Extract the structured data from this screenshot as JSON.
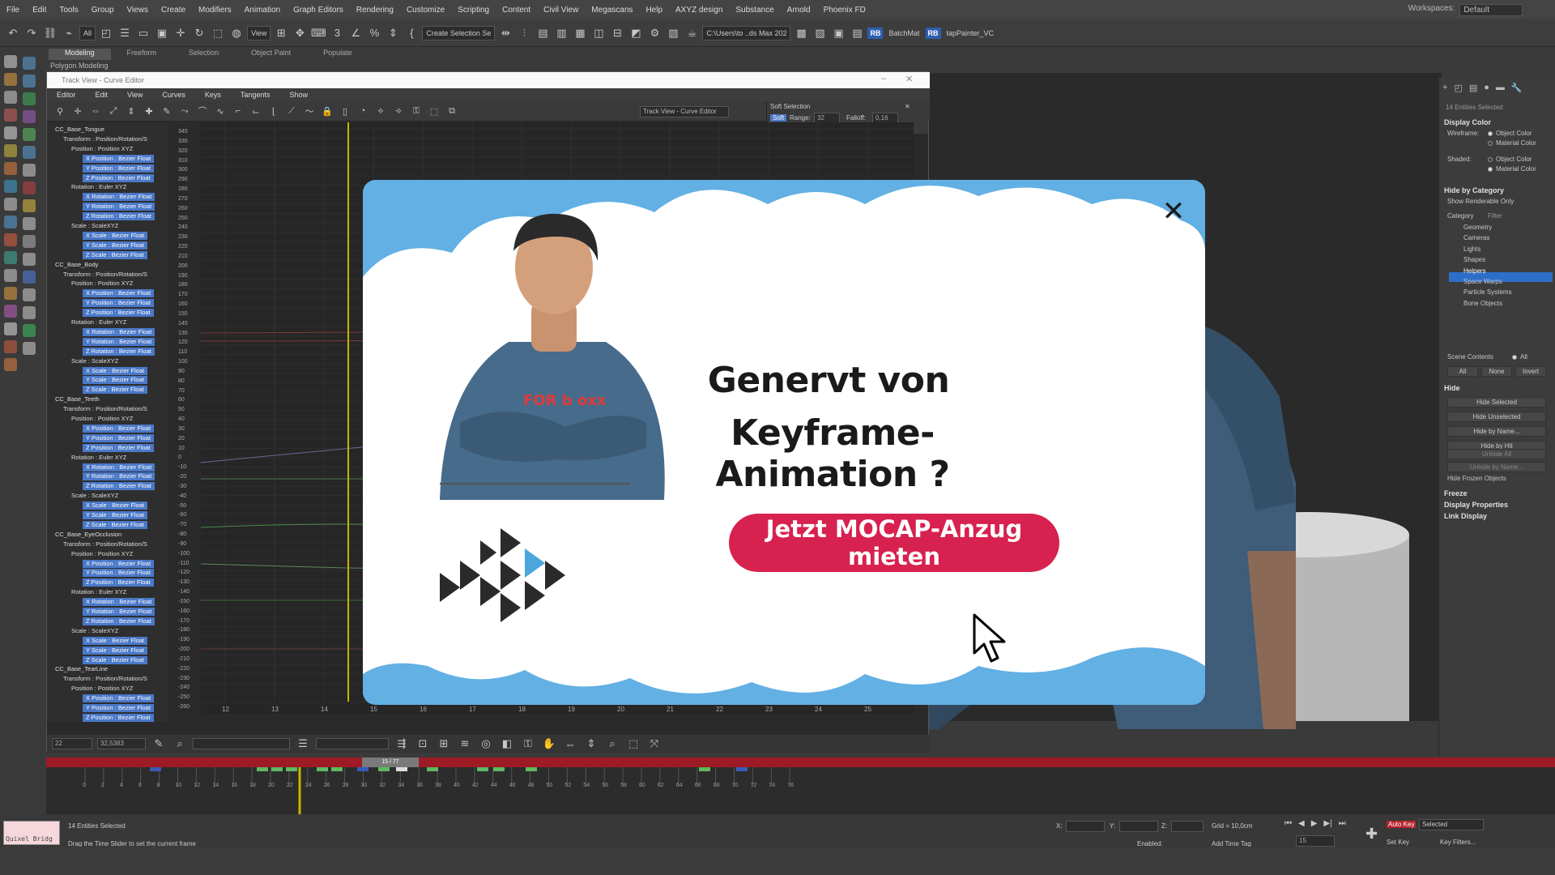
{
  "menubar": {
    "items": [
      "File",
      "Edit",
      "Tools",
      "Group",
      "Views",
      "Create",
      "Modifiers",
      "Animation",
      "Graph Editors",
      "Rendering",
      "Customize",
      "Scripting",
      "Content",
      "Civil View",
      "Megascans",
      "Help",
      "AXYZ design",
      "Substance",
      "Arnold",
      "Phoenix FD"
    ],
    "workspace_label": "Workspaces:",
    "workspace_value": "Default"
  },
  "toolbar": {
    "filter_value": "All",
    "view_value": "View",
    "create_selection_label": "Create Selection Se",
    "path_value": "C:\\Users\\to ..ds Max 202",
    "batchmat_label": "BatchMat",
    "tappainter_label": "tapPainter_VC",
    "rb_label": "RB"
  },
  "ribbon": {
    "tabs": [
      "Modeling",
      "Freeform",
      "Selection",
      "Object Paint",
      "Populate"
    ],
    "active_tab": "Modeling",
    "sub_label": "Polygon Modeling"
  },
  "trackview": {
    "title": "Track View - Curve Editor",
    "menu": [
      "Editor",
      "Edit",
      "View",
      "Curves",
      "Keys",
      "Tangents",
      "Show"
    ],
    "toolbar_field": "Track View - Curve Editor",
    "soft_selection": {
      "title": "Soft Selection",
      "soft_btn": "Soft",
      "range_label": "Range:",
      "range_value": "32",
      "falloff_label": "Falloff:",
      "falloff_value": "0,16"
    },
    "tree": [
      {
        "text": "CC_Base_Tongue",
        "level": 0,
        "hl": false
      },
      {
        "text": "Transform : Position/Rotation/S",
        "level": 1,
        "hl": false
      },
      {
        "text": "Position : Position XYZ",
        "level": 2,
        "hl": false
      },
      {
        "text": "X Position : Bezier Float",
        "level": 3,
        "hl": true
      },
      {
        "text": "Y Position : Bezier Float",
        "level": 3,
        "hl": true
      },
      {
        "text": "Z Position : Bezier Float",
        "level": 3,
        "hl": true
      },
      {
        "text": "Rotation : Euler XYZ",
        "level": 2,
        "hl": false
      },
      {
        "text": "X Rotation : Bezier Float",
        "level": 3,
        "hl": true
      },
      {
        "text": "Y Rotation : Bezier Float",
        "level": 3,
        "hl": true
      },
      {
        "text": "Z Rotation : Bezier Float",
        "level": 3,
        "hl": true
      },
      {
        "text": "Scale : ScaleXYZ",
        "level": 2,
        "hl": false
      },
      {
        "text": "X Scale : Bezier Float",
        "level": 3,
        "hl": true
      },
      {
        "text": "Y Scale : Bezier Float",
        "level": 3,
        "hl": true
      },
      {
        "text": "Z Scale : Bezier Float",
        "level": 3,
        "hl": true
      },
      {
        "text": "CC_Base_Body",
        "level": 0,
        "hl": false
      },
      {
        "text": "Transform : Position/Rotation/S",
        "level": 1,
        "hl": false
      },
      {
        "text": "Position : Position XYZ",
        "level": 2,
        "hl": false
      },
      {
        "text": "X Position : Bezier Float",
        "level": 3,
        "hl": true
      },
      {
        "text": "Y Position : Bezier Float",
        "level": 3,
        "hl": true
      },
      {
        "text": "Z Position : Bezier Float",
        "level": 3,
        "hl": true
      },
      {
        "text": "Rotation : Euler XYZ",
        "level": 2,
        "hl": false
      },
      {
        "text": "X Rotation : Bezier Float",
        "level": 3,
        "hl": true
      },
      {
        "text": "Y Rotation : Bezier Float",
        "level": 3,
        "hl": true
      },
      {
        "text": "Z Rotation : Bezier Float",
        "level": 3,
        "hl": true
      },
      {
        "text": "Scale : ScaleXYZ",
        "level": 2,
        "hl": false
      },
      {
        "text": "X Scale : Bezier Float",
        "level": 3,
        "hl": true
      },
      {
        "text": "Y Scale : Bezier Float",
        "level": 3,
        "hl": true
      },
      {
        "text": "Z Scale : Bezier Float",
        "level": 3,
        "hl": true
      },
      {
        "text": "CC_Base_Teeth",
        "level": 0,
        "hl": false
      },
      {
        "text": "Transform : Position/Rotation/S",
        "level": 1,
        "hl": false
      },
      {
        "text": "Position : Position XYZ",
        "level": 2,
        "hl": false
      },
      {
        "text": "X Position : Bezier Float",
        "level": 3,
        "hl": true
      },
      {
        "text": "Y Position : Bezier Float",
        "level": 3,
        "hl": true
      },
      {
        "text": "Z Position : Bezier Float",
        "level": 3,
        "hl": true
      },
      {
        "text": "Rotation : Euler XYZ",
        "level": 2,
        "hl": false
      },
      {
        "text": "X Rotation : Bezier Float",
        "level": 3,
        "hl": true
      },
      {
        "text": "Y Rotation : Bezier Float",
        "level": 3,
        "hl": true
      },
      {
        "text": "Z Rotation : Bezier Float",
        "level": 3,
        "hl": true
      },
      {
        "text": "Scale : ScaleXYZ",
        "level": 2,
        "hl": false
      },
      {
        "text": "X Scale : Bezier Float",
        "level": 3,
        "hl": true
      },
      {
        "text": "Y Scale : Bezier Float",
        "level": 3,
        "hl": true
      },
      {
        "text": "Z Scale : Bezier Float",
        "level": 3,
        "hl": true
      },
      {
        "text": "CC_Base_EyeOcclusion",
        "level": 0,
        "hl": false
      },
      {
        "text": "Transform : Position/Rotation/S",
        "level": 1,
        "hl": false
      },
      {
        "text": "Position : Position XYZ",
        "level": 2,
        "hl": false
      },
      {
        "text": "X Position : Bezier Float",
        "level": 3,
        "hl": true
      },
      {
        "text": "Y Position : Bezier Float",
        "level": 3,
        "hl": true
      },
      {
        "text": "Z Position : Bezier Float",
        "level": 3,
        "hl": true
      },
      {
        "text": "Rotation : Euler XYZ",
        "level": 2,
        "hl": false
      },
      {
        "text": "X Rotation : Bezier Float",
        "level": 3,
        "hl": true
      },
      {
        "text": "Y Rotation : Bezier Float",
        "level": 3,
        "hl": true
      },
      {
        "text": "Z Rotation : Bezier Float",
        "level": 3,
        "hl": true
      },
      {
        "text": "Scale : ScaleXYZ",
        "level": 2,
        "hl": false
      },
      {
        "text": "X Scale : Bezier Float",
        "level": 3,
        "hl": true
      },
      {
        "text": "Y Scale : Bezier Float",
        "level": 3,
        "hl": true
      },
      {
        "text": "Z Scale : Bezier Float",
        "level": 3,
        "hl": true
      },
      {
        "text": "CC_Base_TearLine",
        "level": 0,
        "hl": false
      },
      {
        "text": "Transform : Position/Rotation/S",
        "level": 1,
        "hl": false
      },
      {
        "text": "Position : Position XYZ",
        "level": 2,
        "hl": false
      },
      {
        "text": "X Position : Bezier Float",
        "level": 3,
        "hl": true
      },
      {
        "text": "Y Position : Bezier Float",
        "level": 3,
        "hl": true
      },
      {
        "text": "Z Position : Bezier Float",
        "level": 3,
        "hl": true
      }
    ],
    "y_ticks": [
      "340",
      "330",
      "320",
      "310",
      "300",
      "290",
      "280",
      "270",
      "260",
      "250",
      "240",
      "230",
      "220",
      "210",
      "200",
      "190",
      "180",
      "170",
      "160",
      "150",
      "140",
      "130",
      "120",
      "110",
      "100",
      "90",
      "80",
      "70",
      "60",
      "50",
      "40",
      "30",
      "20",
      "10",
      "0",
      "-10",
      "-20",
      "-30",
      "-40",
      "-50",
      "-60",
      "-70",
      "-80",
      "-90",
      "-100",
      "-110",
      "-120",
      "-130",
      "-140",
      "-150",
      "-160",
      "-170",
      "-180",
      "-190",
      "-200",
      "-210",
      "-220",
      "-230",
      "-240",
      "-250",
      "-260"
    ],
    "x_ticks": [
      "12",
      "13",
      "14",
      "15",
      "16",
      "17",
      "18",
      "19",
      "20",
      "21",
      "22",
      "23",
      "24",
      "25"
    ],
    "bottom_field1": "22",
    "bottom_field2": "32,5383"
  },
  "timeline": {
    "slider_label": "15 / 77",
    "ticks": [
      "0",
      "2",
      "4",
      "6",
      "8",
      "10",
      "12",
      "14",
      "16",
      "18",
      "20",
      "22",
      "24",
      "26",
      "28",
      "30",
      "32",
      "34",
      "36",
      "38",
      "40",
      "42",
      "44",
      "46",
      "48",
      "50",
      "52",
      "54",
      "56",
      "58",
      "60",
      "62",
      "64",
      "66",
      "68",
      "70",
      "72",
      "74",
      "76"
    ]
  },
  "status": {
    "quixel_label": "Quixel Bridg",
    "entities": "14 Entities Selected",
    "hint": "Drag the Time Slider to set the current frame",
    "x_label": "X:",
    "y_label": "Y:",
    "z_label": "Z:",
    "grid": "Grid = 10,0cm",
    "enabled_label": "Enabled:",
    "add_time_tag": "Add Time Tag",
    "auto_key": "Auto Key",
    "selected": "Selected",
    "set_key": "Set Key",
    "key_filters": "Key Filters...",
    "frame": "15"
  },
  "cmdpanel": {
    "selected_label": "14 Entities Selected",
    "display_color": "Display Color",
    "wireframe_label": "Wireframe:",
    "shaded_label": "Shaded:",
    "object_color": "Object Color",
    "material_color": "Material Color",
    "hide_by_category": "Hide by Category",
    "show_renderable": "Show Renderable Only",
    "category_tab": "Category",
    "filter_tab": "Filter",
    "categories": [
      "Geometry",
      "Cameras",
      "Lights",
      "Shapes",
      "Helpers",
      "Space Warps",
      "Particle Systems",
      "Bone Objects"
    ],
    "selected_category": "Helpers",
    "scene_contents": "Scene Contents",
    "all_label": "All",
    "btn_all": "All",
    "btn_none": "None",
    "btn_invert": "Invert",
    "hide": "Hide",
    "hide_buttons": [
      "Hide Selected",
      "Hide Unselected",
      "Hide by Name...",
      "Hide by Hit"
    ],
    "unhide_buttons": [
      "Unhide All",
      "Unhide by Name..."
    ],
    "hide_frozen": "Hide Frozen Objects",
    "freeze": "Freeze",
    "display_properties": "Display Properties",
    "link_display": "Link Display"
  },
  "ad": {
    "headline_line1": "Genervt von",
    "headline_line2": "Keyframe-Animation ?",
    "cta_label": "Jetzt MOCAP-Anzug mieten",
    "close_glyph": "✕",
    "shirt_text": "FOR b oxx",
    "colors": {
      "sky": "#62b0e4",
      "cloud": "#ffffff",
      "cta": "#d7214e",
      "text": "#1a1a1a",
      "logo_dark": "#2a2a2a",
      "logo_blue": "#4aa6dc"
    }
  }
}
